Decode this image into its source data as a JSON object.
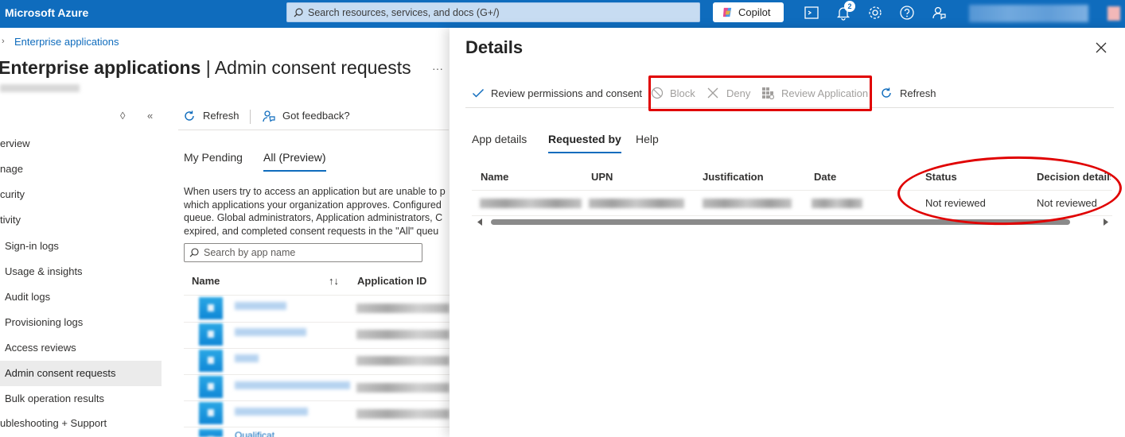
{
  "topbar": {
    "brand": "Microsoft Azure",
    "search_placeholder": "Search resources, services, and docs (G+/)",
    "copilot_label": "Copilot",
    "notification_count": "2",
    "icons": [
      "cloud-shell-icon",
      "bell-icon",
      "gear-icon",
      "help-icon",
      "feedback-icon"
    ]
  },
  "breadcrumb": {
    "item": "Enterprise applications"
  },
  "page": {
    "title_bold": "Enterprise applications",
    "title_rest": " | Admin consent requests",
    "more": "···"
  },
  "sidebar": {
    "items": [
      {
        "label": "erview"
      },
      {
        "label": "nage"
      },
      {
        "label": "curity"
      },
      {
        "label": "tivity"
      },
      {
        "label": "Sign-in logs"
      },
      {
        "label": "Usage & insights"
      },
      {
        "label": "Audit logs"
      },
      {
        "label": "Provisioning logs"
      },
      {
        "label": "Access reviews"
      },
      {
        "label": "Admin consent requests",
        "selected": true
      },
      {
        "label": "Bulk operation results"
      },
      {
        "label": "ubleshooting + Support"
      }
    ]
  },
  "main": {
    "refresh_label": "Refresh",
    "feedback_label": "Got feedback?",
    "tabs": [
      "My Pending",
      "All (Preview)"
    ],
    "description": [
      "When users try to access an application but are unable to p",
      "which applications your organization approves. Configured",
      "queue. Global administrators, Application administrators, C",
      "expired, and completed consent requests in the \"All\" queu"
    ],
    "search_placeholder": "Search by app name",
    "columns": [
      "Name",
      "Application ID"
    ],
    "last_row_partial": "Qualificat"
  },
  "details": {
    "title": "Details",
    "commands": {
      "review_permissions": "Review permissions and consent",
      "block": "Block",
      "deny": "Deny",
      "review_application": "Review Application",
      "refresh": "Refresh"
    },
    "tabs": [
      "App details",
      "Requested by",
      "Help"
    ],
    "active_tab": "Requested by",
    "columns": [
      "Name",
      "UPN",
      "Justification",
      "Date",
      "Status",
      "Decision details"
    ],
    "row": {
      "status": "Not reviewed",
      "decision_details": "Not reviewed"
    },
    "highlight_color": "#e00000"
  }
}
